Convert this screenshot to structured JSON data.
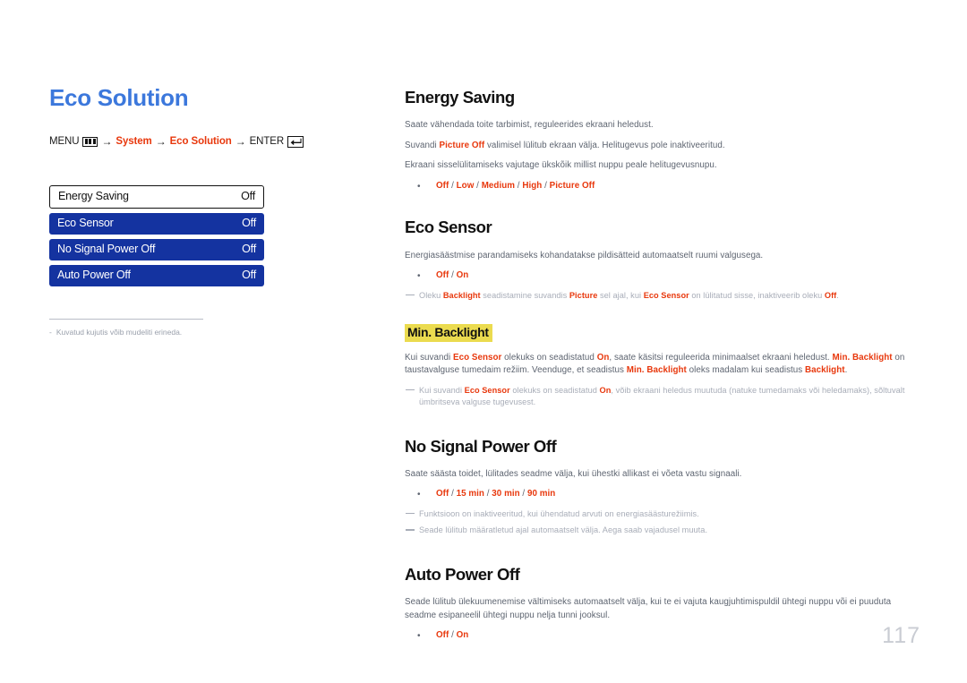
{
  "page": {
    "title": "Eco Solution",
    "number": "117",
    "accent_red": "#e8380d",
    "title_blue": "#3c78dc",
    "osd_blue": "#1433a0",
    "highlight_yellow": "#ebdb4f"
  },
  "breadcrumb": {
    "menu_label": "MENU",
    "menu_icon": "menu-bars-icon",
    "arrow": "→",
    "step1": "System",
    "step2": "Eco Solution",
    "enter_label": "ENTER",
    "enter_icon": "enter-return-icon"
  },
  "osd": {
    "rows": [
      {
        "label": "Energy Saving",
        "value": "Off",
        "selected": true
      },
      {
        "label": "Eco Sensor",
        "value": "Off",
        "selected": false
      },
      {
        "label": "No Signal Power Off",
        "value": "Off",
        "selected": false
      },
      {
        "label": "Auto Power Off",
        "value": "Off",
        "selected": false
      }
    ]
  },
  "left_note": {
    "dash": "-",
    "text": "Kuvatud kujutis võib mudeliti erineda."
  },
  "sections": {
    "energy_saving": {
      "title": "Energy Saving",
      "p1": "Saate vähendada toite tarbimist, reguleerides ekraani heledust.",
      "p2_a": "Suvandi ",
      "p2_kw": "Picture Off",
      "p2_b": " valimisel lülitub ekraan välja. Helitugevus pole inaktiveeritud.",
      "p3": "Ekraani sisselülitamiseks vajutage ükskõik millist nuppu peale helitugevusnupu.",
      "options": [
        "Off",
        "Low",
        "Medium",
        "High",
        "Picture Off"
      ]
    },
    "eco_sensor": {
      "title": "Eco Sensor",
      "p1": "Energiasäästmise parandamiseks kohandatakse pildisätteid automaatselt ruumi valgusega.",
      "options": [
        "Off",
        "On"
      ],
      "note_a": "Oleku ",
      "note_kw1": "Backlight",
      "note_b": " seadistamine suvandis ",
      "note_kw2": "Picture",
      "note_c": " sel ajal, kui ",
      "note_kw3": "Eco Sensor",
      "note_d": " on lülitatud sisse, inaktiveerib oleku ",
      "note_kw4": "Off",
      "note_e": "."
    },
    "min_backlight": {
      "title": "Min. Backlight",
      "p1_a": "Kui suvandi ",
      "p1_kw1": "Eco Sensor",
      "p1_b": " olekuks on seadistatud ",
      "p1_kw2": "On",
      "p1_c": ", saate käsitsi reguleerida minimaalset ekraani heledust. ",
      "p1_kw3": "Min. Backlight",
      "p1_d": " on taustavalguse tumedaim režiim. Veenduge, et seadistus ",
      "p1_kw4": "Min. Backlight",
      "p1_e": " oleks madalam kui seadistus ",
      "p1_kw5": "Backlight",
      "p1_f": ".",
      "note_a": "Kui suvandi ",
      "note_kw1": "Eco Sensor",
      "note_b": " olekuks on seadistatud ",
      "note_kw2": "On",
      "note_c": ", võib ekraani heledus muutuda (natuke tumedamaks või heledamaks), sõltuvalt ümbritseva valguse tugevusest."
    },
    "no_signal_power_off": {
      "title": "No Signal Power Off",
      "p1": "Saate säästa toidet, lülitades seadme välja, kui ühestki allikast ei võeta vastu signaali.",
      "options": [
        "Off",
        "15 min",
        "30 min",
        "90 min"
      ],
      "note1": "Funktsioon on inaktiveeritud, kui ühendatud arvuti on energiasäästurežiimis.",
      "note2": "Seade lülitub määratletud ajal automaatselt välja. Aega saab vajadusel muuta."
    },
    "auto_power_off": {
      "title": "Auto Power Off",
      "p1": "Seade lülitub ülekuumenemise vältimiseks automaatselt välja, kui te ei vajuta kaugjuhtimispuldil ühtegi nuppu või ei puuduta seadme esipaneelil ühtegi nuppu nelja tunni jooksul.",
      "options": [
        "Off",
        "On"
      ]
    }
  }
}
